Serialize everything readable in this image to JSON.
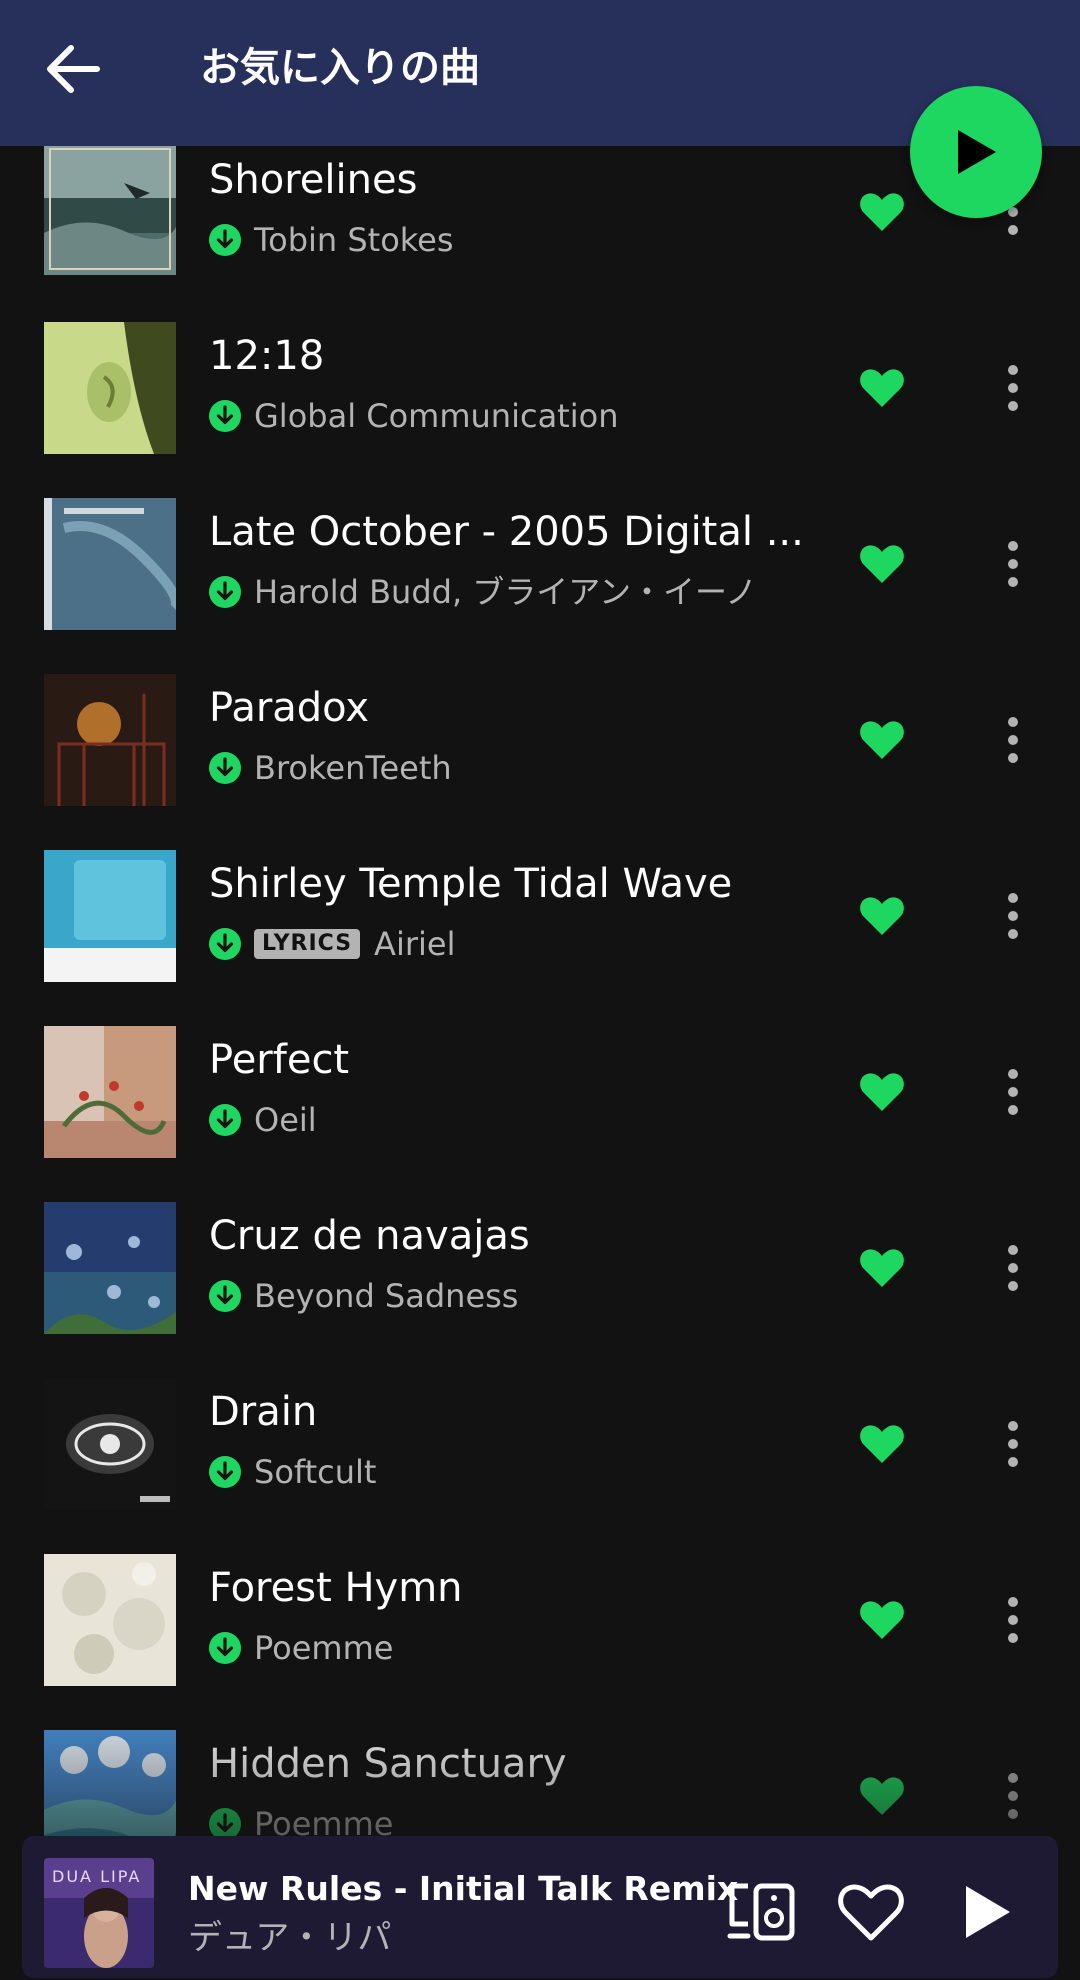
{
  "header": {
    "title": "お気に入りの曲",
    "back_icon": "arrow-left-icon",
    "background": "#27305a"
  },
  "play_button": {
    "icon": "play-icon",
    "color": "#1ed760"
  },
  "tracks": [
    {
      "title": "Shorelines",
      "artist": "Tobin Stokes",
      "lyrics": "",
      "liked": true
    },
    {
      "title": "12:18",
      "artist": "Global Communication",
      "lyrics": "",
      "liked": true
    },
    {
      "title": "Late October - 2005 Digital ...",
      "artist": "Harold Budd, ブライアン・イーノ",
      "lyrics": "",
      "liked": true
    },
    {
      "title": "Paradox",
      "artist": "BrokenTeeth",
      "lyrics": "",
      "liked": true
    },
    {
      "title": "Shirley Temple Tidal Wave",
      "artist": "Airiel",
      "lyrics": "LYRICS",
      "liked": true
    },
    {
      "title": "Perfect",
      "artist": "Oeil",
      "lyrics": "",
      "liked": true
    },
    {
      "title": "Cruz de navajas",
      "artist": "Beyond Sadness",
      "lyrics": "",
      "liked": true
    },
    {
      "title": "Drain",
      "artist": "Softcult",
      "lyrics": "",
      "liked": true
    },
    {
      "title": "Forest Hymn",
      "artist": "Poemme",
      "lyrics": "",
      "liked": true
    },
    {
      "title": "Hidden Sanctuary",
      "artist": "Poemme",
      "lyrics": "",
      "liked": true
    }
  ],
  "mini_player": {
    "title": "New Rules - Initial Talk Remix",
    "artist": "デュア・リパ",
    "device_icon": "connect-device-icon",
    "heart_icon": "heart-outline-icon",
    "play_icon": "play-icon"
  },
  "colors": {
    "accent": "#1ed760",
    "background": "#121212",
    "secondary_text": "#b3b3b3",
    "mini_player_bg": "#1f1a33"
  }
}
